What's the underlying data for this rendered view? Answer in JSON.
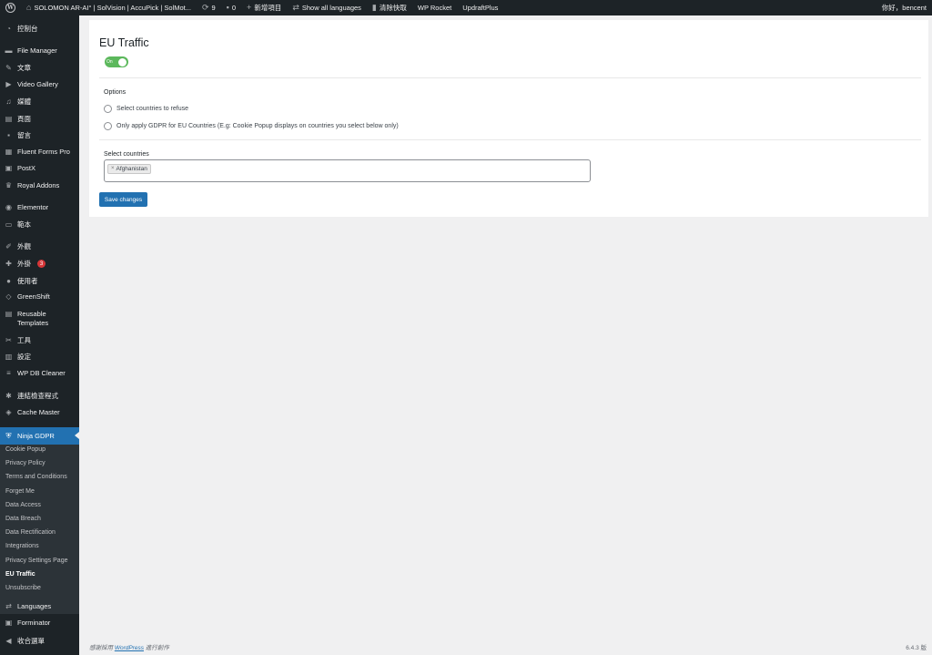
{
  "adminbar": {
    "site_name": "SOLOMON AR-AI° | SolVision | AccuPick | SolMot...",
    "updates_count": "9",
    "comments_count": "0",
    "new_label": "新增項目",
    "languages_label": "Show all languages",
    "clear_cache_label": "清除快取",
    "wp_rocket_label": "WP Rocket",
    "updraft_label": "UpdraftPlus",
    "greeting": "你好，bencent"
  },
  "sidebar": {
    "items": [
      {
        "label": "控制台",
        "icon": "dashboard-icon"
      },
      {
        "label": "File Manager",
        "icon": "folder-icon"
      },
      {
        "label": "文章",
        "icon": "pin-icon"
      },
      {
        "label": "Video Gallery",
        "icon": "video-icon"
      },
      {
        "label": "媒體",
        "icon": "media-icon"
      },
      {
        "label": "頁面",
        "icon": "page-icon"
      },
      {
        "label": "留言",
        "icon": "comment-icon"
      },
      {
        "label": "Fluent Forms Pro",
        "icon": "form-icon"
      },
      {
        "label": "PostX",
        "icon": "postx-icon"
      },
      {
        "label": "Royal Addons",
        "icon": "crown-icon"
      },
      {
        "label": "Elementor",
        "icon": "elementor-icon"
      },
      {
        "label": "範本",
        "icon": "template-icon"
      },
      {
        "label": "外觀",
        "icon": "brush-icon"
      },
      {
        "label": "外掛",
        "icon": "plugin-icon",
        "badge": "3"
      },
      {
        "label": "使用者",
        "icon": "user-icon"
      },
      {
        "label": "GreenShift",
        "icon": "greenshift-icon"
      },
      {
        "label": "Reusable Templates",
        "icon": "reusable-icon"
      },
      {
        "label": "工具",
        "icon": "wrench-icon"
      },
      {
        "label": "設定",
        "icon": "settings-icon"
      },
      {
        "label": "WP DB Cleaner",
        "icon": "database-icon"
      },
      {
        "label": "連結檢查程式",
        "icon": "link-check-icon"
      },
      {
        "label": "Cache Master",
        "icon": "cache-icon"
      },
      {
        "label": "Ninja GDPR",
        "icon": "shield-icon"
      },
      {
        "label": "Languages",
        "icon": "translate-icon"
      },
      {
        "label": "Forminator",
        "icon": "forminator-icon"
      },
      {
        "label": "收合選單",
        "icon": "collapse-icon"
      }
    ],
    "submenu": [
      "Cookie Popup",
      "Privacy Policy",
      "Terms and Conditions",
      "Forget Me",
      "Data Access",
      "Data Breach",
      "Data Rectification",
      "Integrations",
      "Privacy Settings Page",
      "EU Traffic",
      "Unsubscribe"
    ]
  },
  "main": {
    "title": "EU Traffic",
    "toggle_label": "On",
    "toggle_on": true,
    "options_label": "Options",
    "radio_refuse": "Select countries to refuse",
    "radio_gdpr": "Only apply GDPR for EU Countries (E.g: Cookie Popup displays on countries you select below only)",
    "select_label": "Select countries",
    "selected_tag": "Afghanistan",
    "save_label": "Save changes"
  },
  "footer": {
    "thanks_prefix": "感謝採用",
    "wordpress_link": "WordPress",
    "thanks_suffix": "進行創作",
    "version": "6.4.3 版"
  },
  "colors": {
    "adminbar_bg": "#1d2327",
    "accent": "#2271b1",
    "toggle_on": "#5cb85c",
    "badge": "#d63638"
  }
}
